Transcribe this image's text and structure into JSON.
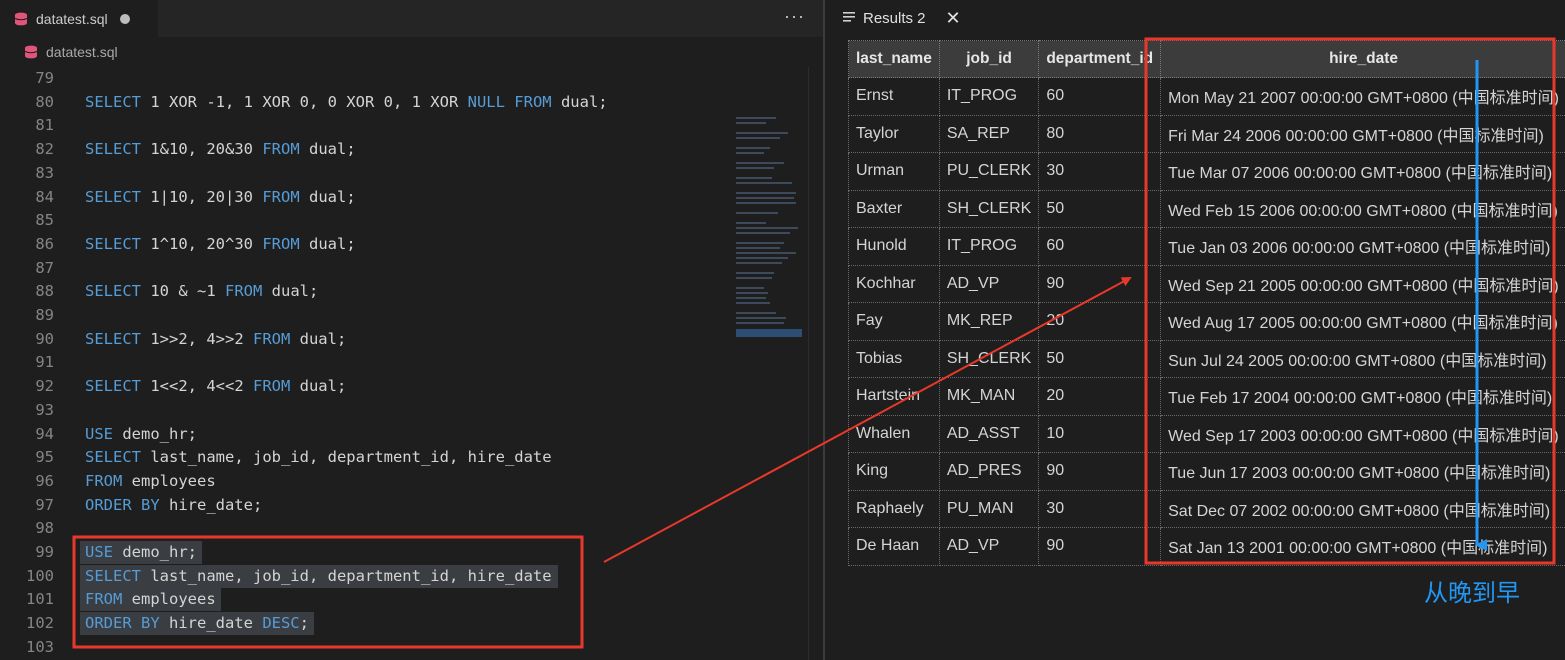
{
  "editor": {
    "tab": {
      "label": "datatest.sql",
      "modified": true
    },
    "breadcrumb": {
      "label": "datatest.sql"
    },
    "lines": [
      {
        "n": "79",
        "tokens": []
      },
      {
        "n": "80",
        "tokens": [
          [
            "kw",
            "SELECT"
          ],
          [
            "t",
            " 1 XOR -1, 1 XOR 0, 0 XOR 0, 1 XOR "
          ],
          [
            "kw",
            "NULL"
          ],
          [
            "t",
            " "
          ],
          [
            "kw",
            "FROM"
          ],
          [
            "t",
            " dual;"
          ]
        ]
      },
      {
        "n": "81",
        "tokens": []
      },
      {
        "n": "82",
        "tokens": [
          [
            "kw",
            "SELECT"
          ],
          [
            "t",
            " 1&10, 20&30 "
          ],
          [
            "kw",
            "FROM"
          ],
          [
            "t",
            " dual;"
          ]
        ]
      },
      {
        "n": "83",
        "tokens": []
      },
      {
        "n": "84",
        "tokens": [
          [
            "kw",
            "SELECT"
          ],
          [
            "t",
            " 1|10, 20|30 "
          ],
          [
            "kw",
            "FROM"
          ],
          [
            "t",
            " dual;"
          ]
        ]
      },
      {
        "n": "85",
        "tokens": []
      },
      {
        "n": "86",
        "tokens": [
          [
            "kw",
            "SELECT"
          ],
          [
            "t",
            " 1^10, 20^30 "
          ],
          [
            "kw",
            "FROM"
          ],
          [
            "t",
            " dual;"
          ]
        ]
      },
      {
        "n": "87",
        "tokens": []
      },
      {
        "n": "88",
        "tokens": [
          [
            "kw",
            "SELECT"
          ],
          [
            "t",
            " 10 & ~1 "
          ],
          [
            "kw",
            "FROM"
          ],
          [
            "t",
            " dual;"
          ]
        ]
      },
      {
        "n": "89",
        "tokens": []
      },
      {
        "n": "90",
        "tokens": [
          [
            "kw",
            "SELECT"
          ],
          [
            "t",
            " 1>>2, 4>>2 "
          ],
          [
            "kw",
            "FROM"
          ],
          [
            "t",
            " dual;"
          ]
        ]
      },
      {
        "n": "91",
        "tokens": []
      },
      {
        "n": "92",
        "tokens": [
          [
            "kw",
            "SELECT"
          ],
          [
            "t",
            " 1<<2, 4<<2 "
          ],
          [
            "kw",
            "FROM"
          ],
          [
            "t",
            " dual;"
          ]
        ]
      },
      {
        "n": "93",
        "tokens": []
      },
      {
        "n": "94",
        "tokens": [
          [
            "kw",
            "USE"
          ],
          [
            "t",
            " demo_hr;"
          ]
        ]
      },
      {
        "n": "95",
        "tokens": [
          [
            "kw",
            "SELECT"
          ],
          [
            "t",
            " last_name, job_id, department_id, hire_date"
          ]
        ]
      },
      {
        "n": "96",
        "tokens": [
          [
            "kw",
            "FROM"
          ],
          [
            "t",
            " employees"
          ]
        ]
      },
      {
        "n": "97",
        "tokens": [
          [
            "kw",
            "ORDER BY"
          ],
          [
            "t",
            " hire_date;"
          ]
        ]
      },
      {
        "n": "98",
        "tokens": []
      },
      {
        "n": "99",
        "tokens": [
          [
            "kw",
            "USE"
          ],
          [
            "t",
            " demo_hr;"
          ]
        ],
        "selected": true
      },
      {
        "n": "100",
        "tokens": [
          [
            "kw",
            "SELECT"
          ],
          [
            "t",
            " last_name, job_id, department_id, hire_date"
          ]
        ],
        "selected": true
      },
      {
        "n": "101",
        "tokens": [
          [
            "kw",
            "FROM"
          ],
          [
            "t",
            " employees"
          ]
        ],
        "selected": true
      },
      {
        "n": "102",
        "tokens": [
          [
            "kw",
            "ORDER BY"
          ],
          [
            "t",
            " hire_date "
          ],
          [
            "kw",
            "DESC"
          ],
          [
            "t",
            ";"
          ]
        ],
        "selected": true
      },
      {
        "n": "103",
        "tokens": []
      }
    ]
  },
  "results": {
    "tab_label": "Results 2",
    "columns": [
      "last_name",
      "job_id",
      "department_id",
      "hire_date"
    ],
    "rows": [
      [
        "Ernst",
        "IT_PROG",
        "60",
        "Mon May 21 2007 00:00:00 GMT+0800 (中国标准时间)"
      ],
      [
        "Taylor",
        "SA_REP",
        "80",
        "Fri Mar 24 2006 00:00:00 GMT+0800 (中国标准时间)"
      ],
      [
        "Urman",
        "PU_CLERK",
        "30",
        "Tue Mar 07 2006 00:00:00 GMT+0800 (中国标准时间)"
      ],
      [
        "Baxter",
        "SH_CLERK",
        "50",
        "Wed Feb 15 2006 00:00:00 GMT+0800 (中国标准时间)"
      ],
      [
        "Hunold",
        "IT_PROG",
        "60",
        "Tue Jan 03 2006 00:00:00 GMT+0800 (中国标准时间)"
      ],
      [
        "Kochhar",
        "AD_VP",
        "90",
        "Wed Sep 21 2005 00:00:00 GMT+0800 (中国标准时间)"
      ],
      [
        "Fay",
        "MK_REP",
        "20",
        "Wed Aug 17 2005 00:00:00 GMT+0800 (中国标准时间)"
      ],
      [
        "Tobias",
        "SH_CLERK",
        "50",
        "Sun Jul 24 2005 00:00:00 GMT+0800 (中国标准时间)"
      ],
      [
        "Hartstein",
        "MK_MAN",
        "20",
        "Tue Feb 17 2004 00:00:00 GMT+0800 (中国标准时间)"
      ],
      [
        "Whalen",
        "AD_ASST",
        "10",
        "Wed Sep 17 2003 00:00:00 GMT+0800 (中国标准时间)"
      ],
      [
        "King",
        "AD_PRES",
        "90",
        "Tue Jun 17 2003 00:00:00 GMT+0800 (中国标准时间)"
      ],
      [
        "Raphaely",
        "PU_MAN",
        "30",
        "Sat Dec 07 2002 00:00:00 GMT+0800 (中国标准时间)"
      ],
      [
        "De Haan",
        "AD_VP",
        "90",
        "Sat Jan 13 2001 00:00:00 GMT+0800 (中国标准时间)"
      ]
    ]
  },
  "annotation": {
    "note": "从晚到早",
    "highlight_color": "#e8382c",
    "arrow_color": "#2196f3"
  },
  "colors": {
    "keyword": "#569cd6",
    "text": "#d4d4d4",
    "line_number": "#858585",
    "db_icon": "#e0567a"
  }
}
